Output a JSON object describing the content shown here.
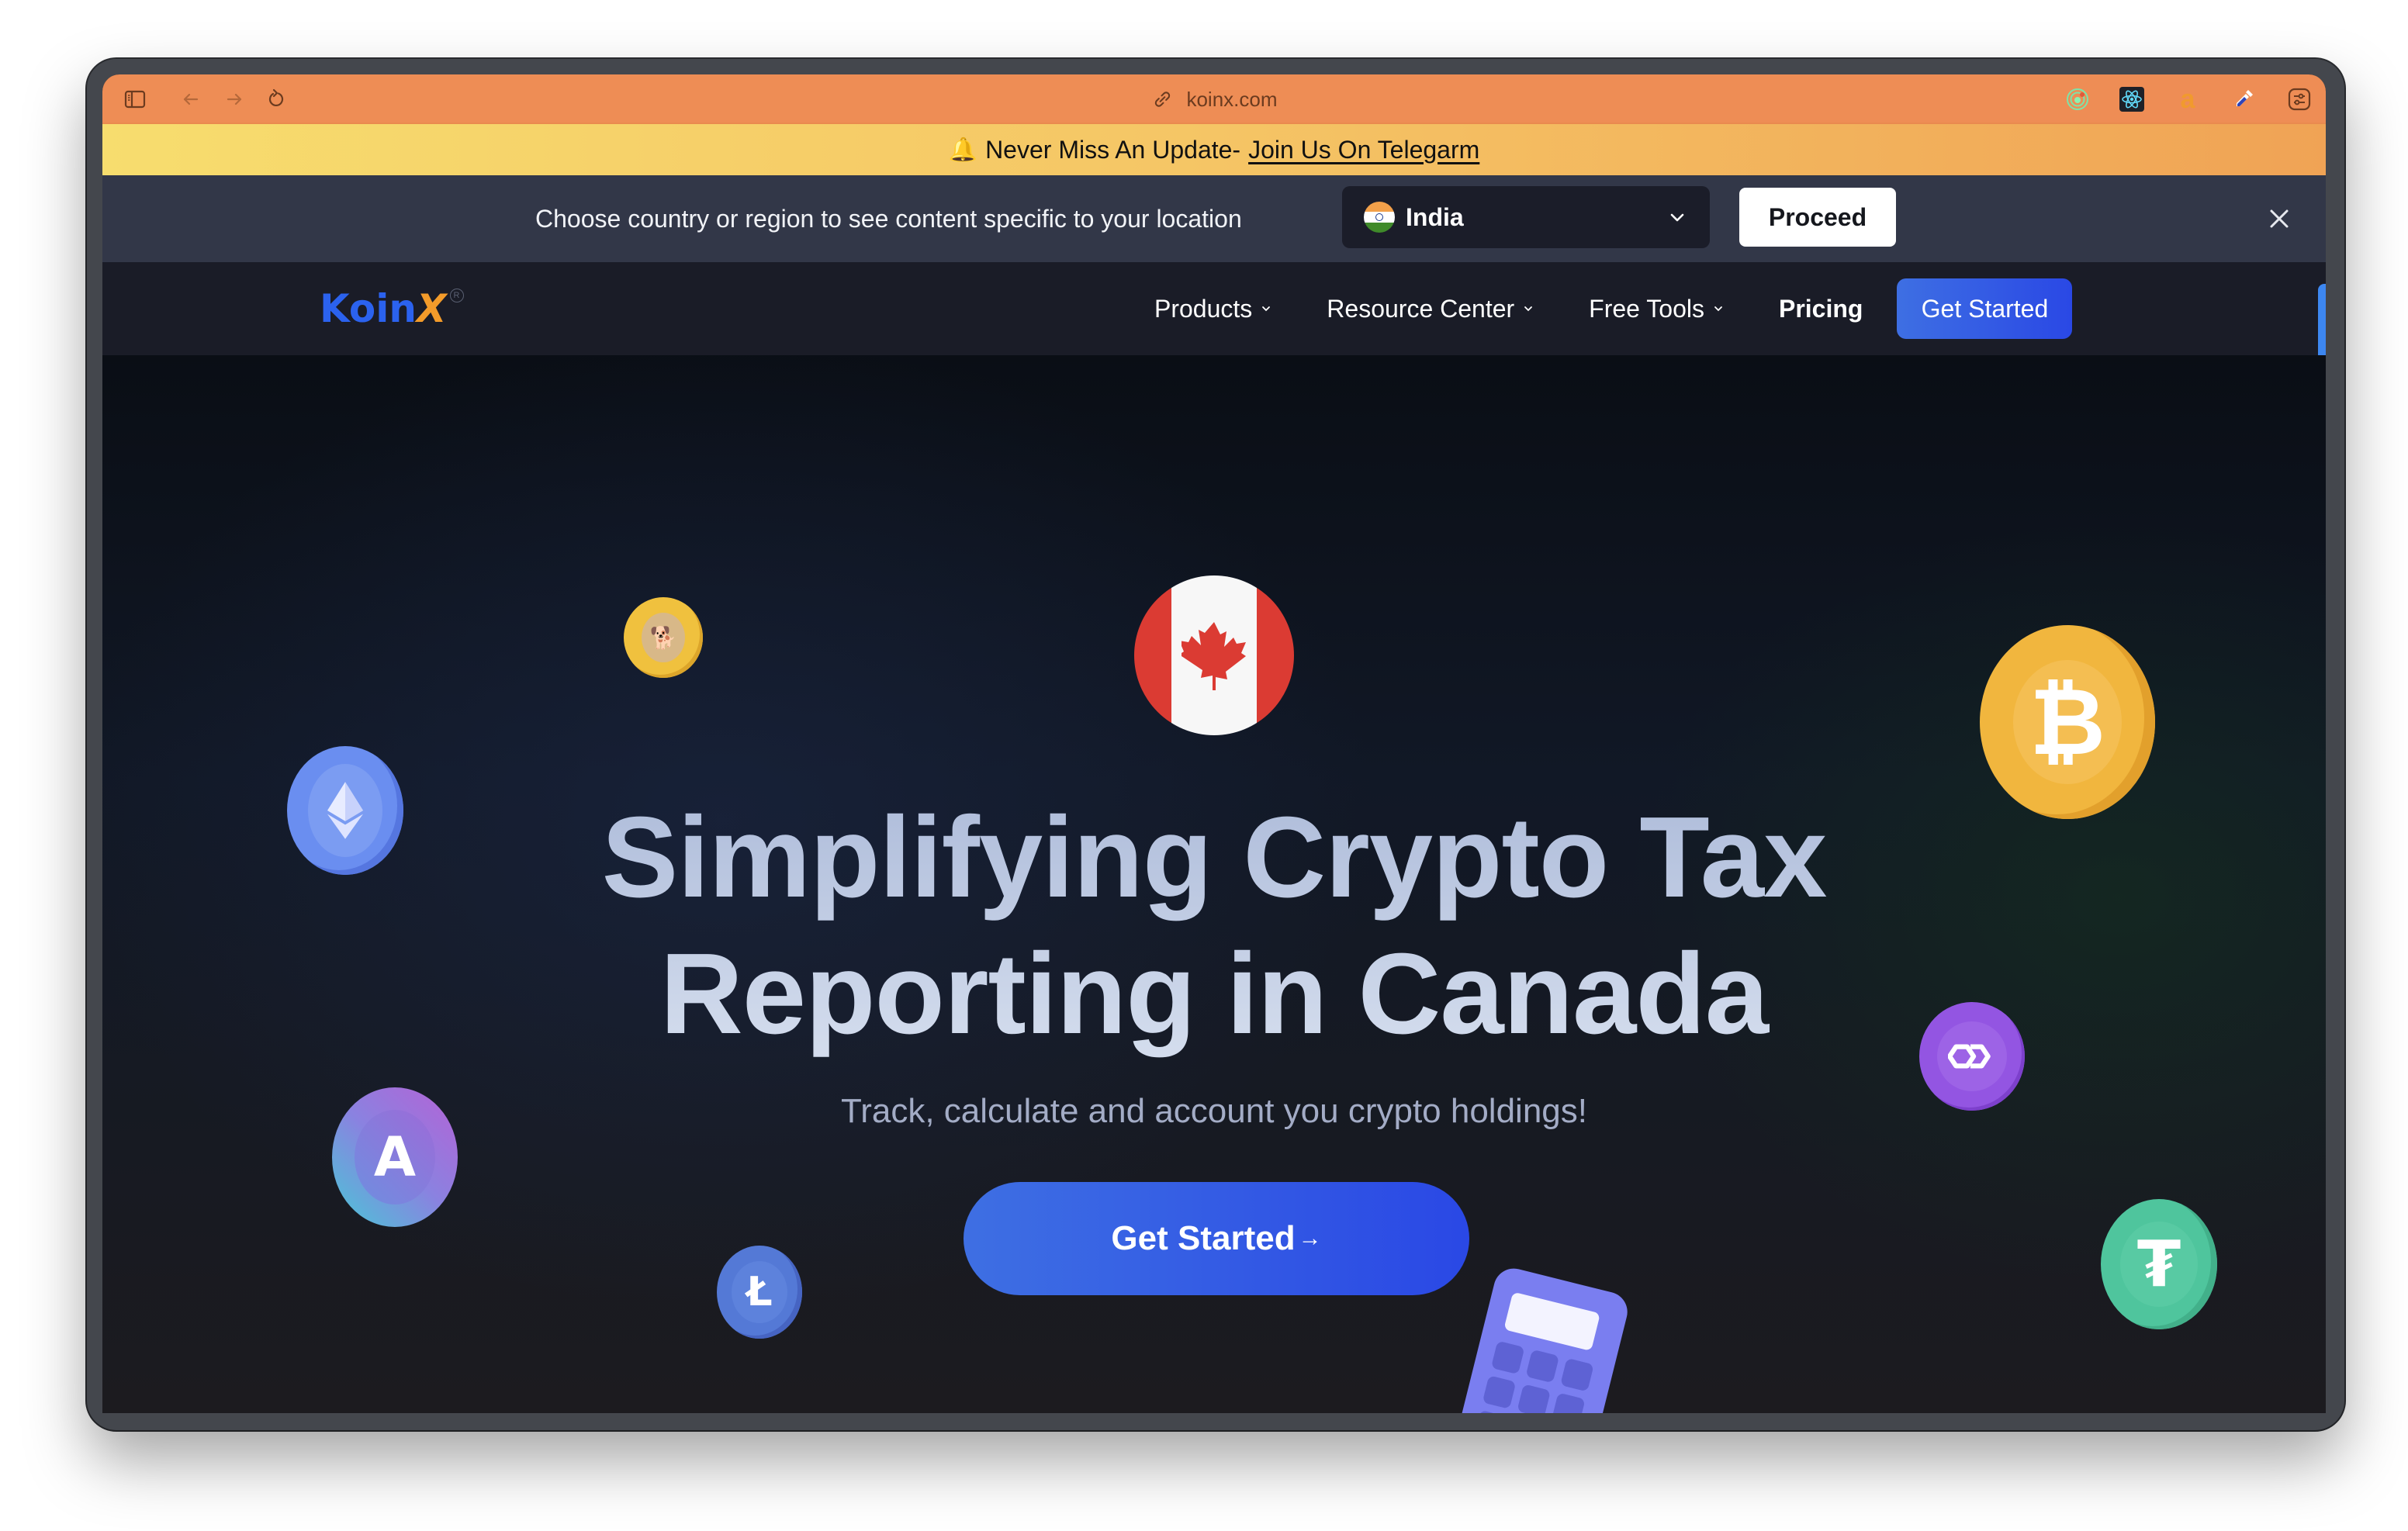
{
  "browser": {
    "url": "koinx.com",
    "toolbar_icons_left": [
      "sidebar-icon",
      "back-icon",
      "forward-icon",
      "reload-icon"
    ],
    "extension_icons": [
      "radar-extension-icon",
      "react-devtools-icon",
      "amazon-extension-icon",
      "eyedropper-extension-icon",
      "settings-sliders-icon",
      "split-view-icon"
    ]
  },
  "promo_banner": {
    "icon": "bell-icon",
    "text": "Never Miss An Update-",
    "link_text": "Join Us On Telegarm"
  },
  "region_bar": {
    "message": "Choose country or region to see content specific to your location",
    "selected_country": "India",
    "proceed_label": "Proceed",
    "close_icon": "close-icon"
  },
  "nav": {
    "logo": {
      "primary": "Koin",
      "accent": "X",
      "registered": "R"
    },
    "items": [
      {
        "label": "Products",
        "has_dropdown": true
      },
      {
        "label": "Resource Center",
        "has_dropdown": true
      },
      {
        "label": "Free Tools",
        "has_dropdown": true
      },
      {
        "label": "Pricing",
        "has_dropdown": false
      }
    ],
    "cta_label": "Get Started"
  },
  "hero": {
    "flag": "canada-flag",
    "headline_line1": "Simplifying Crypto Tax",
    "headline_line2": "Reporting in Canada",
    "subheadline": "Track, calculate and account you crypto holdings!",
    "cta_label": "Get Started",
    "cta_arrow": "→",
    "coins": {
      "doge": "",
      "eth": "",
      "btc": "₿",
      "polygon": "",
      "aave": "A",
      "litecoin": "Ł",
      "tether": "₮"
    }
  },
  "colors": {
    "toolbar": "#ee8d55",
    "region_bar": "#323748",
    "nav_bg": "#1a1c27",
    "brand_blue": "#2b62ee",
    "brand_orange": "#f39b2a",
    "cta_gradient_start": "#3e6fe3",
    "cta_gradient_end": "#2a48e5",
    "headline": "#c5d1e6"
  }
}
